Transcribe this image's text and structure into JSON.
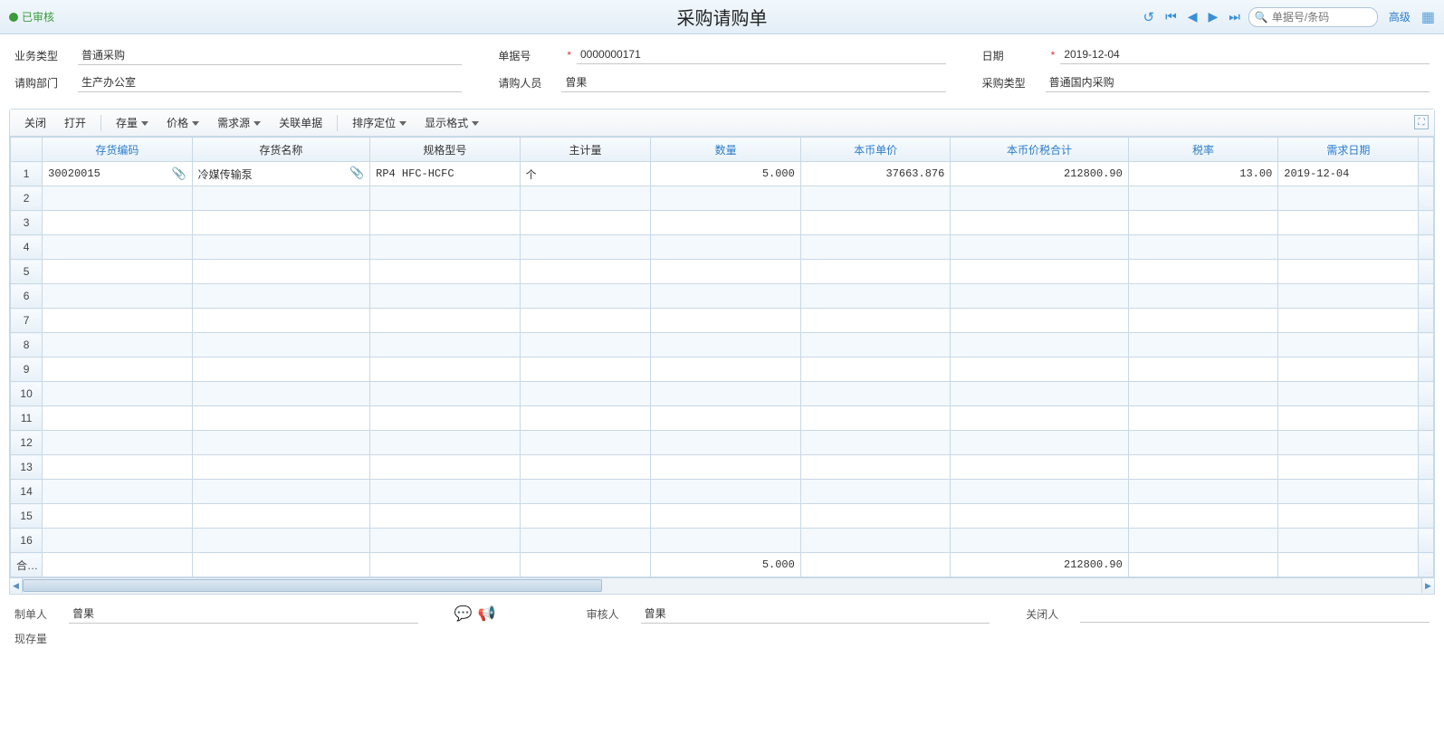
{
  "header": {
    "status": "已审核",
    "title": "采购请购单",
    "search_placeholder": "单据号/条码",
    "advanced": "高级"
  },
  "form": {
    "business_type_label": "业务类型",
    "business_type": "普通采购",
    "doc_no_label": "单据号",
    "doc_no": "0000000171",
    "date_label": "日期",
    "date": "2019-12-04",
    "dept_label": "请购部门",
    "dept": "生产办公室",
    "person_label": "请购人员",
    "person": "曾果",
    "purchase_type_label": "采购类型",
    "purchase_type": "普通国内采购"
  },
  "toolbar": {
    "close": "关闭",
    "open": "打开",
    "stock": "存量",
    "price": "价格",
    "demand": "需求源",
    "related": "关联单据",
    "sort": "排序定位",
    "display": "显示格式"
  },
  "columns": {
    "code": "存货编码",
    "name": "存货名称",
    "spec": "规格型号",
    "uom": "主计量",
    "qty": "数量",
    "price": "本币单价",
    "amount": "本币价税合计",
    "tax": "税率",
    "reqdate": "需求日期"
  },
  "rows": [
    {
      "n": "1",
      "code": "30020015",
      "name": "冷媒传输泵",
      "spec": "RP4 HFC-HCFC",
      "uom": "个",
      "qty": "5.000",
      "price": "37663.876",
      "amount": "212800.90",
      "tax": "13.00",
      "reqdate": "2019-12-04"
    }
  ],
  "empty_rows": [
    "2",
    "3",
    "4",
    "5",
    "6",
    "7",
    "8",
    "9",
    "10",
    "11",
    "12",
    "13",
    "14",
    "15",
    "16"
  ],
  "totals": {
    "label": "合计",
    "qty": "5.000",
    "amount": "212800.90"
  },
  "footer": {
    "creator_label": "制单人",
    "creator": "曾果",
    "auditor_label": "审核人",
    "auditor": "曾果",
    "closer_label": "关闭人",
    "closer": "",
    "stock_label": "现存量"
  }
}
